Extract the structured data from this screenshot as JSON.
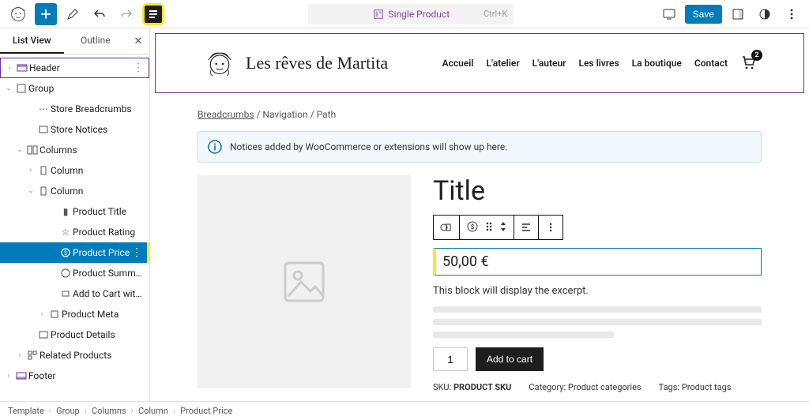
{
  "topbar": {
    "doc_label": "Single Product",
    "shortcut": "Ctrl+K",
    "save": "Save"
  },
  "sidepanel": {
    "tabs": {
      "list": "List View",
      "outline": "Outline"
    },
    "tree": {
      "header": "Header",
      "group": "Group",
      "store_breadcrumbs": "Store Breadcrumbs",
      "store_notices": "Store Notices",
      "columns": "Columns",
      "column": "Column",
      "product_title": "Product Title",
      "product_rating": "Product Rating",
      "product_price": "Product Price",
      "product_summary": "Product Summary",
      "add_to_cart": "Add to Cart with Options",
      "product_meta": "Product Meta",
      "product_details": "Product Details",
      "related_products": "Related Products",
      "footer": "Footer"
    }
  },
  "site": {
    "brand": "Les rêves de Martita",
    "nav": [
      "Accueil",
      "L'atelier",
      "L'auteur",
      "Les livres",
      "La boutique",
      "Contact"
    ],
    "cart_count": "2"
  },
  "breadcrumbs": {
    "first": "Breadcrumbs",
    "rest": " / Navigation / Path"
  },
  "notice": "Notices added by WooCommerce or extensions will show up here.",
  "product": {
    "title": "Title",
    "price": "50,00 €",
    "excerpt": "This block will display the excerpt.",
    "qty": "1",
    "add_to_cart": "Add to cart",
    "sku_label": "SKU:",
    "sku": "PRODUCT SKU",
    "cat_label": "Category:",
    "cat": "Product categories",
    "tags_label": "Tags:",
    "tags": "Product tags"
  },
  "footer_path": [
    "Template",
    "Group",
    "Columns",
    "Column",
    "Product Price"
  ]
}
